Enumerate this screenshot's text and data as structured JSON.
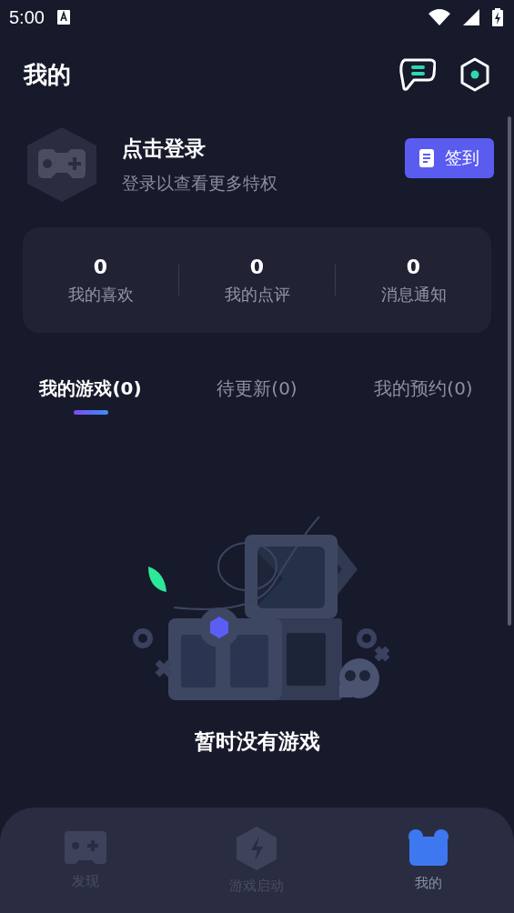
{
  "status_bar": {
    "time": "5:00"
  },
  "header": {
    "title": "我的"
  },
  "profile": {
    "name": "点击登录",
    "subtitle": "登录以查看更多特权",
    "checkin_button": "签到"
  },
  "stats": [
    {
      "value": "0",
      "label": "我的喜欢"
    },
    {
      "value": "0",
      "label": "我的点评"
    },
    {
      "value": "0",
      "label": "消息通知"
    }
  ],
  "tabs": [
    {
      "label": "我的游戏(0)",
      "selected": true
    },
    {
      "label": "待更新(0)",
      "selected": false
    },
    {
      "label": "我的预约(0)",
      "selected": false
    }
  ],
  "empty_state": {
    "message": "暂时没有游戏"
  },
  "bottom_nav": [
    {
      "label": "发现",
      "kind": "gamepad",
      "selected": false
    },
    {
      "label": "游戏启动",
      "kind": "bolt",
      "selected": false
    },
    {
      "label": "我的",
      "kind": "profile",
      "selected": true
    }
  ]
}
